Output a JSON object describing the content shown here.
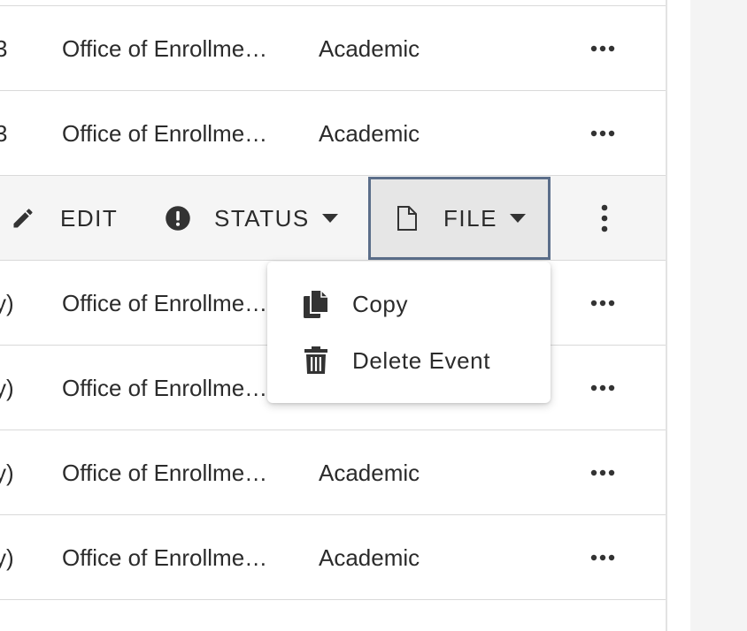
{
  "table": {
    "rows_top": [
      {
        "col1": "3",
        "col2": "Office of Enrollme…",
        "col3": "Academic"
      },
      {
        "col1": "3",
        "col2": "Office of Enrollme…",
        "col3": "Academic"
      }
    ],
    "rows_bottom": [
      {
        "col1": "y)",
        "col2": "Office of Enrollme…",
        "col3": ""
      },
      {
        "col1": "y)",
        "col2": "Office of Enrollme…",
        "col3": ""
      },
      {
        "col1": "y)",
        "col2": "Office of Enrollme…",
        "col3": "Academic"
      },
      {
        "col1": "y)",
        "col2": "Office of Enrollme…",
        "col3": "Academic"
      }
    ]
  },
  "toolbar": {
    "edit_label": "EDIT",
    "status_label": "STATUS",
    "file_label": "FILE"
  },
  "file_menu": {
    "items": [
      {
        "label": "Copy",
        "icon": "copy-icon"
      },
      {
        "label": "Delete Event",
        "icon": "trash-icon"
      }
    ]
  },
  "colors": {
    "text": "#2b2b2b",
    "selected_row_bg": "#f5f5f5",
    "file_button_border": "#5b6e8a",
    "file_button_bg": "#e6e6e6",
    "side_panel_bg": "#f4f4f4",
    "divider": "#d9d9d9"
  }
}
